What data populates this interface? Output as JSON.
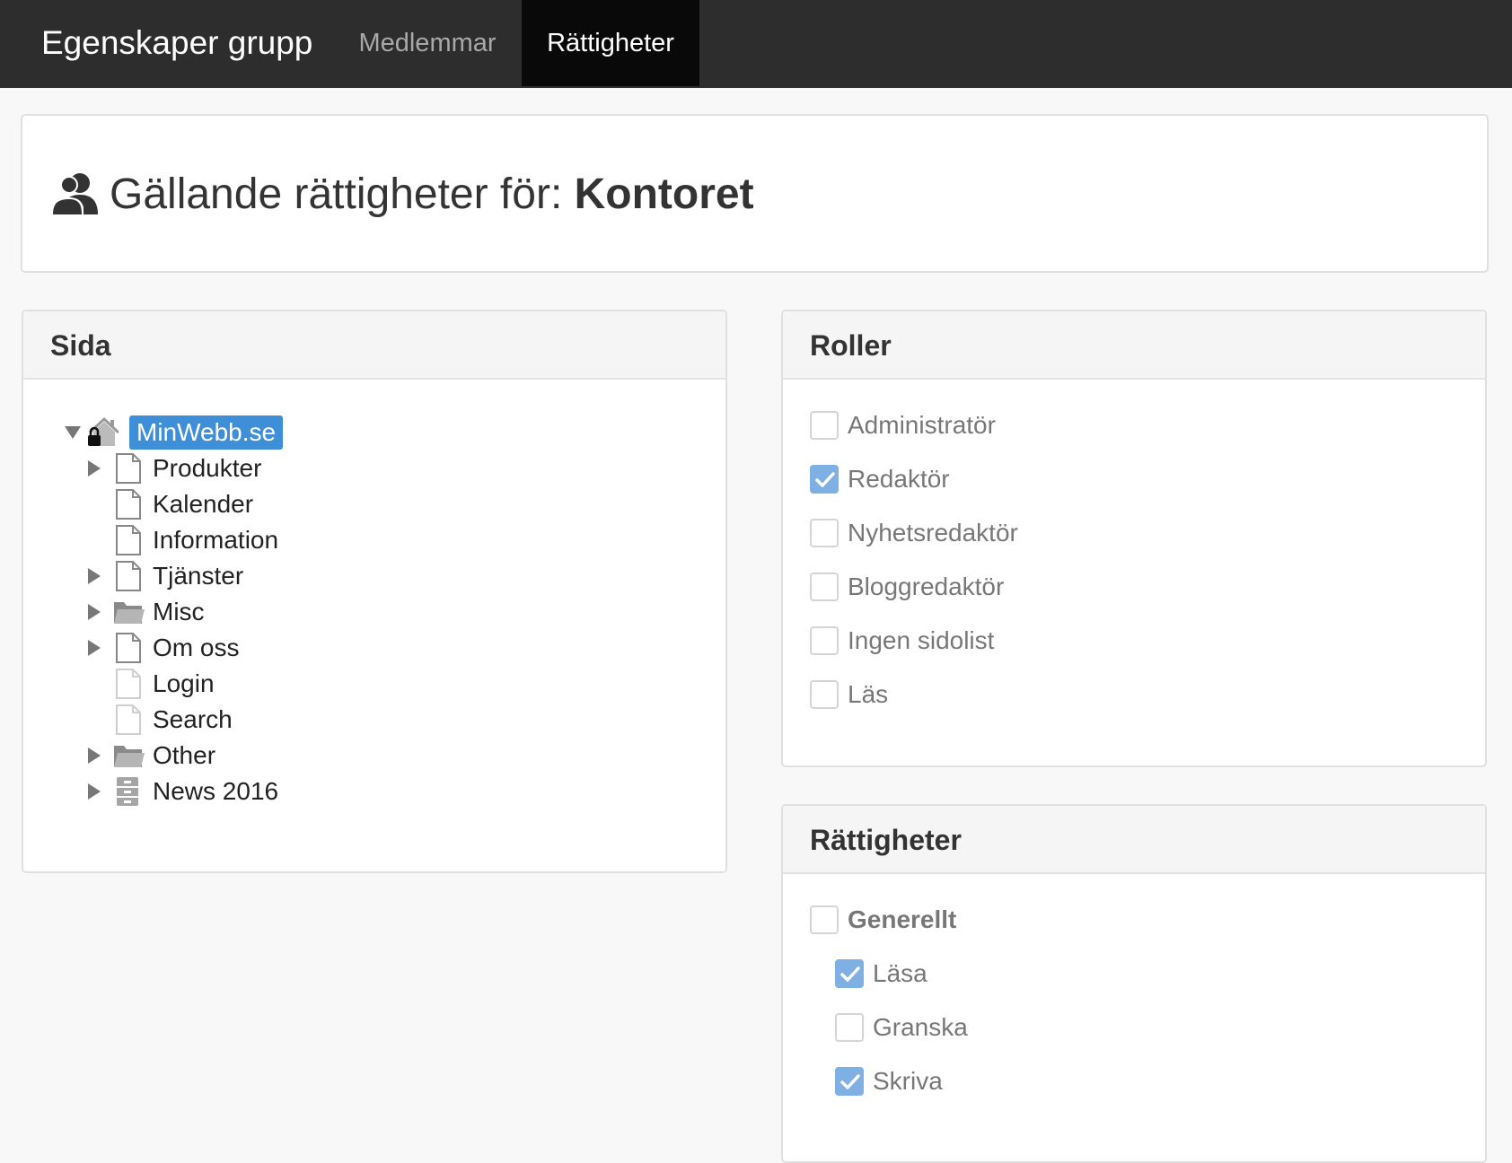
{
  "navbar": {
    "brand": "Egenskaper grupp",
    "tabs": [
      {
        "label": "Medlemmar",
        "active": false
      },
      {
        "label": "Rättigheter",
        "active": true
      }
    ]
  },
  "title": {
    "prefix": "Gällande rättigheter för: ",
    "group": "Kontoret",
    "icon": "users-icon"
  },
  "sida": {
    "heading": "Sida",
    "root": {
      "label": "MinWebb.se",
      "icon": "home-lock-icon",
      "expanded": true
    },
    "items": [
      {
        "label": "Produkter",
        "icon": "page-icon",
        "expandable": true
      },
      {
        "label": "Kalender",
        "icon": "page-icon",
        "expandable": false
      },
      {
        "label": "Information",
        "icon": "page-icon",
        "expandable": false
      },
      {
        "label": "Tjänster",
        "icon": "page-icon",
        "expandable": true
      },
      {
        "label": "Misc",
        "icon": "folder-icon",
        "expandable": true
      },
      {
        "label": "Om oss",
        "icon": "page-icon",
        "expandable": true
      },
      {
        "label": "Login",
        "icon": "page-light-icon",
        "expandable": false
      },
      {
        "label": "Search",
        "icon": "page-light-icon",
        "expandable": false
      },
      {
        "label": "Other",
        "icon": "folder-icon",
        "expandable": true
      },
      {
        "label": "News 2016",
        "icon": "archive-icon",
        "expandable": true
      }
    ]
  },
  "roller": {
    "heading": "Roller",
    "items": [
      {
        "label": "Administratör",
        "checked": false
      },
      {
        "label": "Redaktör",
        "checked": true
      },
      {
        "label": "Nyhetsredaktör",
        "checked": false
      },
      {
        "label": "Bloggredaktör",
        "checked": false
      },
      {
        "label": "Ingen sidolist",
        "checked": false
      },
      {
        "label": "Läs",
        "checked": false
      }
    ]
  },
  "rattigheter": {
    "heading": "Rättigheter",
    "group": {
      "label": "Generellt",
      "checked": false
    },
    "items": [
      {
        "label": "Läsa",
        "checked": true
      },
      {
        "label": "Granska",
        "checked": false
      },
      {
        "label": "Skriva",
        "checked": true
      }
    ]
  },
  "colors": {
    "navbar": "#2d2d2d",
    "active_tab": "#090909",
    "selection": "#3f8fd8",
    "checkbox_checked": "#7fb0e3"
  }
}
